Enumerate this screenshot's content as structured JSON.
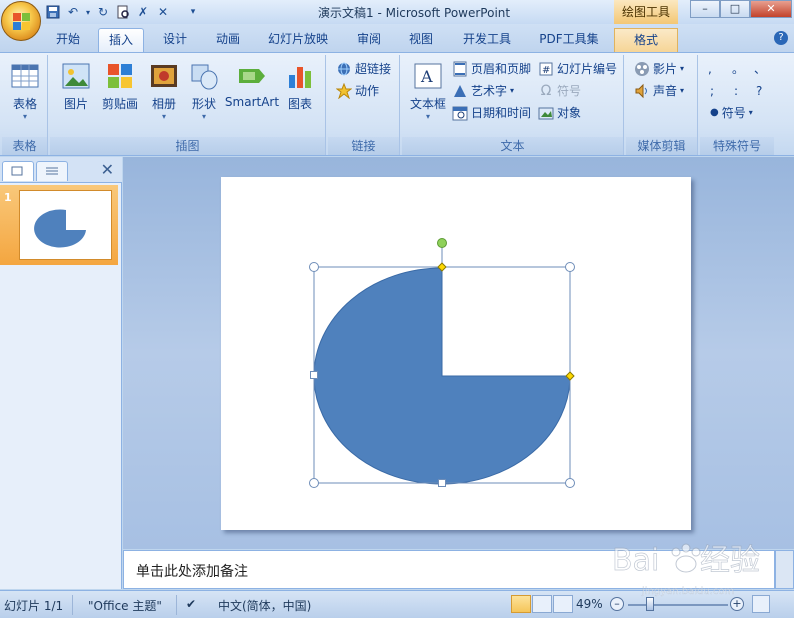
{
  "window": {
    "title": "演示文稿1 - Microsoft PowerPoint",
    "context_tab_title": "绘图工具"
  },
  "tabs": [
    {
      "label": "开始"
    },
    {
      "label": "插入",
      "active": true
    },
    {
      "label": "设计"
    },
    {
      "label": "动画"
    },
    {
      "label": "幻灯片放映"
    },
    {
      "label": "审阅"
    },
    {
      "label": "视图"
    },
    {
      "label": "开发工具"
    },
    {
      "label": "PDF工具集"
    },
    {
      "label": "格式",
      "context": true
    }
  ],
  "ribbon": {
    "groups": {
      "tables": "表格",
      "illustrations": "插图",
      "links": "链接",
      "text": "文本",
      "media": "媒体剪辑",
      "symbols": "特殊符号"
    },
    "buttons": {
      "table": "表格",
      "picture": "图片",
      "clipart": "剪贴画",
      "album": "相册",
      "shapes": "形状",
      "smartart": "SmartArt",
      "chart": "图表",
      "hyperlink": "超链接",
      "action": "动作",
      "textbox": "文本框",
      "header_footer": "页眉和页脚",
      "wordart": "艺术字",
      "datetime": "日期和时间",
      "slide_number": "幻灯片编号",
      "symbol": "符号",
      "object": "对象",
      "movie": "影片",
      "sound": "声音",
      "special_symbol": "符号"
    },
    "symbol_grid": [
      ",",
      "。",
      "、",
      ";",
      ":",
      "?"
    ]
  },
  "slide_panel": {
    "slide_number": "1"
  },
  "notes": {
    "placeholder": "单击此处添加备注"
  },
  "status": {
    "slide_info": "幻灯片 1/1",
    "theme": "\"Office 主题\"",
    "language": "中文(简体，中国)",
    "zoom": "49%"
  },
  "shape": {
    "type": "pie",
    "fill": "#4f81bd",
    "missing_quadrant": "top-right"
  },
  "colors": {
    "accent": "#4f81bd",
    "ribbon_text": "#15428b",
    "adjust_handle": "#ffd800",
    "rotate_handle": "#8fd15a"
  }
}
